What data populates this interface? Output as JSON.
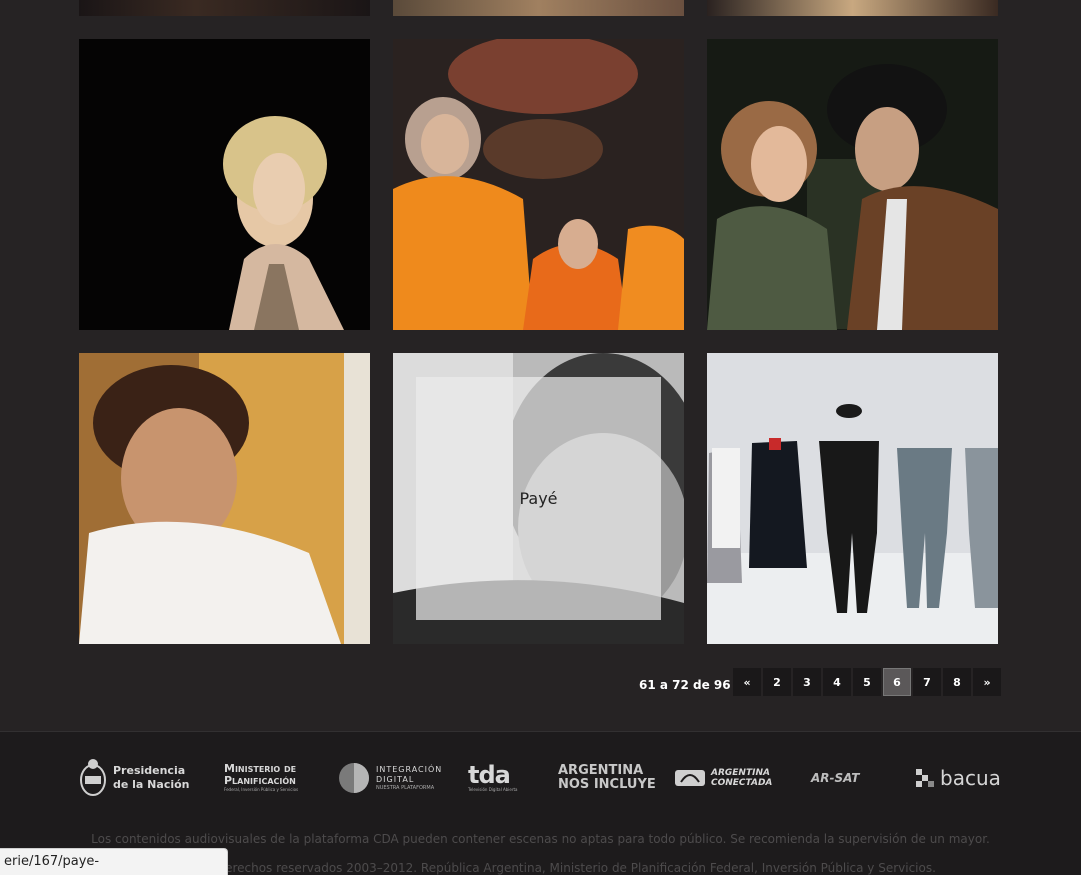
{
  "grid": {
    "overlay_title": "Payé"
  },
  "pagination": {
    "summary": "61 a 72 de 96",
    "prev": "«",
    "pages": [
      "2",
      "3",
      "4",
      "5",
      "6",
      "7",
      "8"
    ],
    "current": "6",
    "next": "»"
  },
  "footer": {
    "logos": {
      "presidencia_1": "Presidencia",
      "presidencia_2": "de la Nación",
      "ministerio_1": "Ministerio de",
      "ministerio_2": "Planificación",
      "ministerio_3": "Federal, Inversión Pública y Servicios",
      "integracion_1": "Integración",
      "integracion_2": "Digital",
      "integracion_3": "Nuestra plataforma",
      "tda": "tda",
      "tda_sub": "Televisión Digital Abierta",
      "argentina_1": "ARGENTINA",
      "argentina_2": "NOS INCLUYE",
      "conectada_1": "ARGENTINA",
      "conectada_2": "CONECTADA",
      "arsat": "AR-SAT",
      "bacua": "bacua"
    },
    "disclaimer": "Los contenidos audiovisuales de la plataforma CDA pueden contener escenas no aptas para todo público. Se recomienda la supervisión de un mayor.",
    "copyright": "erechos reservados 2003–2012. República Argentina, Ministerio de Planificación Federal, Inversión Pública y Servicios."
  },
  "status_bar": {
    "url": "erie/167/paye-"
  },
  "colors": {
    "background": "#262324",
    "footer": "#1d1b1c",
    "pager_active": "#5b5859"
  }
}
